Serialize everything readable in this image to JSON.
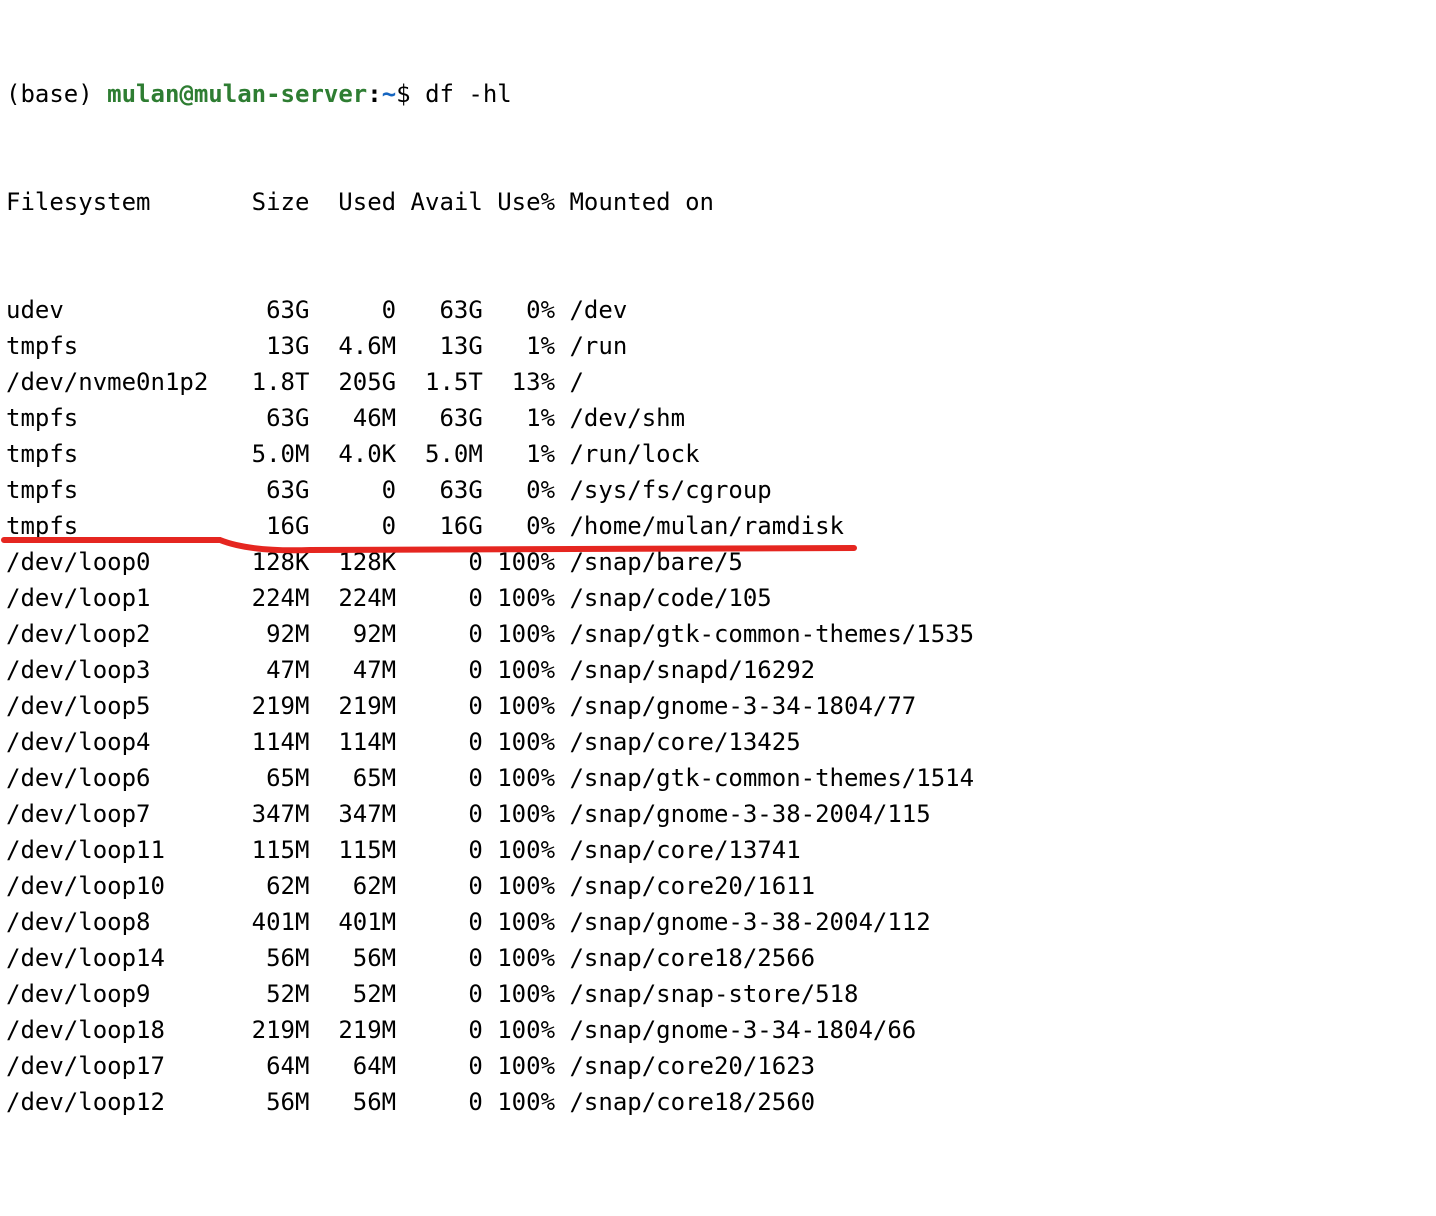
{
  "prompt": {
    "env": "(base) ",
    "user": "mulan",
    "at": "@",
    "host": "mulan-server",
    "colon": ":",
    "path": "~",
    "dollar": "$ ",
    "command": "df -hl"
  },
  "headers": {
    "fs": "Filesystem",
    "size": "Size",
    "used": " Used",
    "avail": "Avail",
    "usep": "Use%",
    "mnt": "Mounted on"
  },
  "rows": [
    {
      "fs": "udev",
      "size": "63G",
      "used": "0",
      "avail": "63G",
      "usep": "0%",
      "mnt": "/dev"
    },
    {
      "fs": "tmpfs",
      "size": "13G",
      "used": "4.6M",
      "avail": "13G",
      "usep": "1%",
      "mnt": "/run"
    },
    {
      "fs": "/dev/nvme0n1p2",
      "size": "1.8T",
      "used": "205G",
      "avail": "1.5T",
      "usep": "13%",
      "mnt": "/"
    },
    {
      "fs": "tmpfs",
      "size": "63G",
      "used": "46M",
      "avail": "63G",
      "usep": "1%",
      "mnt": "/dev/shm"
    },
    {
      "fs": "tmpfs",
      "size": "5.0M",
      "used": "4.0K",
      "avail": "5.0M",
      "usep": "1%",
      "mnt": "/run/lock"
    },
    {
      "fs": "tmpfs",
      "size": "63G",
      "used": "0",
      "avail": "63G",
      "usep": "0%",
      "mnt": "/sys/fs/cgroup"
    },
    {
      "fs": "tmpfs",
      "size": "16G",
      "used": "0",
      "avail": "16G",
      "usep": "0%",
      "mnt": "/home/mulan/ramdisk"
    },
    {
      "fs": "/dev/loop0",
      "size": "128K",
      "used": "128K",
      "avail": "0",
      "usep": "100%",
      "mnt": "/snap/bare/5"
    },
    {
      "fs": "/dev/loop1",
      "size": "224M",
      "used": "224M",
      "avail": "0",
      "usep": "100%",
      "mnt": "/snap/code/105"
    },
    {
      "fs": "/dev/loop2",
      "size": "92M",
      "used": "92M",
      "avail": "0",
      "usep": "100%",
      "mnt": "/snap/gtk-common-themes/1535"
    },
    {
      "fs": "/dev/loop3",
      "size": "47M",
      "used": "47M",
      "avail": "0",
      "usep": "100%",
      "mnt": "/snap/snapd/16292"
    },
    {
      "fs": "/dev/loop5",
      "size": "219M",
      "used": "219M",
      "avail": "0",
      "usep": "100%",
      "mnt": "/snap/gnome-3-34-1804/77"
    },
    {
      "fs": "/dev/loop4",
      "size": "114M",
      "used": "114M",
      "avail": "0",
      "usep": "100%",
      "mnt": "/snap/core/13425"
    },
    {
      "fs": "/dev/loop6",
      "size": "65M",
      "used": "65M",
      "avail": "0",
      "usep": "100%",
      "mnt": "/snap/gtk-common-themes/1514"
    },
    {
      "fs": "/dev/loop7",
      "size": "347M",
      "used": "347M",
      "avail": "0",
      "usep": "100%",
      "mnt": "/snap/gnome-3-38-2004/115"
    },
    {
      "fs": "/dev/loop11",
      "size": "115M",
      "used": "115M",
      "avail": "0",
      "usep": "100%",
      "mnt": "/snap/core/13741"
    },
    {
      "fs": "/dev/loop10",
      "size": "62M",
      "used": "62M",
      "avail": "0",
      "usep": "100%",
      "mnt": "/snap/core20/1611"
    },
    {
      "fs": "/dev/loop8",
      "size": "401M",
      "used": "401M",
      "avail": "0",
      "usep": "100%",
      "mnt": "/snap/gnome-3-38-2004/112"
    },
    {
      "fs": "/dev/loop14",
      "size": "56M",
      "used": "56M",
      "avail": "0",
      "usep": "100%",
      "mnt": "/snap/core18/2566"
    },
    {
      "fs": "/dev/loop9",
      "size": "52M",
      "used": "52M",
      "avail": "0",
      "usep": "100%",
      "mnt": "/snap/snap-store/518"
    },
    {
      "fs": "/dev/loop18",
      "size": "219M",
      "used": "219M",
      "avail": "0",
      "usep": "100%",
      "mnt": "/snap/gnome-3-34-1804/66"
    },
    {
      "fs": "/dev/loop17",
      "size": "64M",
      "used": "64M",
      "avail": "0",
      "usep": "100%",
      "mnt": "/snap/core20/1623"
    },
    {
      "fs": "/dev/loop12",
      "size": "56M",
      "used": "56M",
      "avail": "0",
      "usep": "100%",
      "mnt": "/snap/core18/2560"
    }
  ],
  "annotation": {
    "color": "#e52620",
    "stroke_width": 6,
    "highlight_row_index": 6
  }
}
